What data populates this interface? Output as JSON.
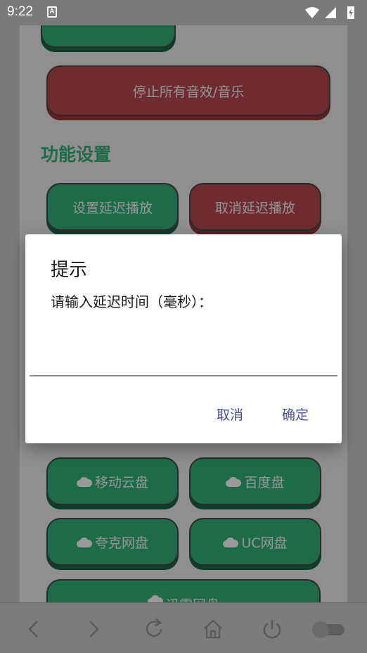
{
  "status_bar": {
    "time": "9:22",
    "notification_icon": "A"
  },
  "buttons": {
    "stop_all": "停止所有音效/音乐",
    "set_delay": "设置延迟播放",
    "cancel_delay": "取消延迟播放",
    "mobile_cloud": "移动云盘",
    "baidu_disk": "百度盘",
    "quark_disk": "夸克网盘",
    "uc_disk": "UC网盘",
    "xunlei_disk": "迅雷网盘"
  },
  "section": {
    "title": "功能设置"
  },
  "dialog": {
    "title": "提示",
    "message": "请输入延迟时间（毫秒）：",
    "input_value": "",
    "cancel_label": "取消",
    "confirm_label": "确定"
  },
  "colors": {
    "accent_green": "#1e6b4a",
    "accent_red": "#6e2c2e",
    "dialog_button": "#4b4f9e"
  }
}
